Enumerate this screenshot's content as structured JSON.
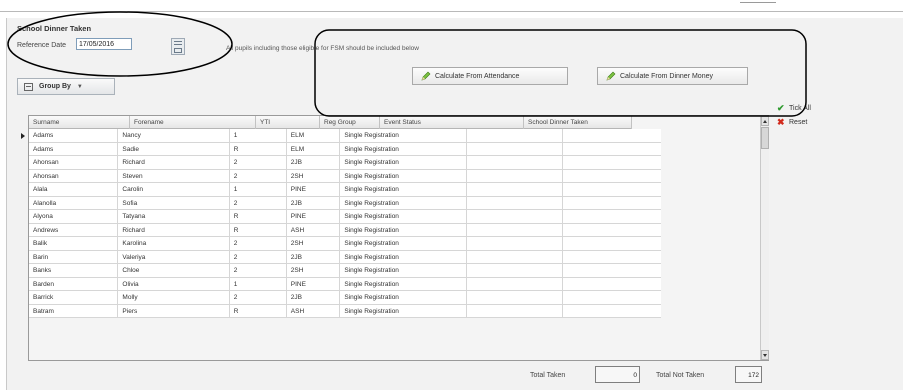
{
  "section": {
    "title": "School Dinner Taken"
  },
  "reference": {
    "label": "Reference Date",
    "value": "17/05/2016",
    "calendar_icon": "calendar-icon"
  },
  "info_text": "All pupils including those eligible for FSM should be included below",
  "buttons": {
    "calc_attendance": "Calculate From Attendance",
    "calc_dinner_money": "Calculate From Dinner Money",
    "group_by": "Group By",
    "tick_all": "Tick All",
    "reset": "Reset"
  },
  "grid": {
    "columns": [
      "Surname",
      "Forename",
      "YTI",
      "Reg Group",
      "Event Status",
      "School Dinner Taken"
    ],
    "rows": [
      [
        "Adams",
        "Nancy",
        "1",
        "ELM",
        "Single Registration",
        ""
      ],
      [
        "Adams",
        "Sadie",
        "R",
        "ELM",
        "Single Registration",
        ""
      ],
      [
        "Ahonsan",
        "Richard",
        "2",
        "2JB",
        "Single Registration",
        ""
      ],
      [
        "Ahonsan",
        "Steven",
        "2",
        "2SH",
        "Single Registration",
        ""
      ],
      [
        "Alala",
        "Carolin",
        "1",
        "PINE",
        "Single Registration",
        ""
      ],
      [
        "Alanolla",
        "Sofia",
        "2",
        "2JB",
        "Single Registration",
        ""
      ],
      [
        "Alyona",
        "Tatyana",
        "R",
        "PINE",
        "Single Registration",
        ""
      ],
      [
        "Andrews",
        "Richard",
        "R",
        "ASH",
        "Single Registration",
        ""
      ],
      [
        "Balik",
        "Karolina",
        "2",
        "2SH",
        "Single Registration",
        ""
      ],
      [
        "Barin",
        "Valeriya",
        "2",
        "2JB",
        "Single Registration",
        ""
      ],
      [
        "Banks",
        "Chloe",
        "2",
        "2SH",
        "Single Registration",
        ""
      ],
      [
        "Barden",
        "Olivia",
        "1",
        "PINE",
        "Single Registration",
        ""
      ],
      [
        "Barrick",
        "Molly",
        "2",
        "2JB",
        "Single Registration",
        ""
      ],
      [
        "Batram",
        "Piers",
        "R",
        "ASH",
        "Single Registration",
        ""
      ]
    ]
  },
  "totals": {
    "taken_label": "Total Taken",
    "taken_value": "0",
    "not_taken_label": "Total Not Taken",
    "not_taken_value": "172"
  }
}
